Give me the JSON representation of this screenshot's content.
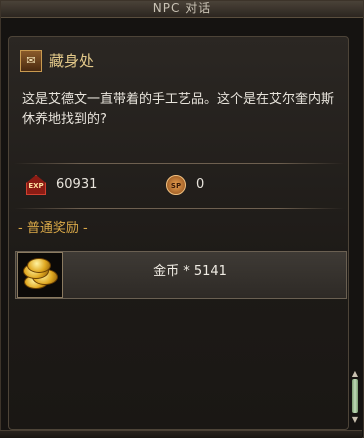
{
  "window": {
    "title": "NPC 对话"
  },
  "header": {
    "icon": "scroll-badge-icon",
    "title": "藏身处"
  },
  "dialog": {
    "text": "这是艾德文一直带着的手工艺品。这个是在艾尔奎内斯休养地找到的?"
  },
  "stats": {
    "exp": {
      "icon": "exp-icon",
      "icon_text": "EXP",
      "value": "60931"
    },
    "sp": {
      "icon": "sp-icon",
      "icon_text": "SP",
      "value": "0"
    }
  },
  "rewards": {
    "section_label": "- 普通奖励 -",
    "items": [
      {
        "icon": "gold-coins-icon",
        "text": "金币 * 5141"
      }
    ]
  },
  "colors": {
    "title_gold": "#e3c98a",
    "section_orange": "#d9a848",
    "text": "#e8e4dc"
  }
}
